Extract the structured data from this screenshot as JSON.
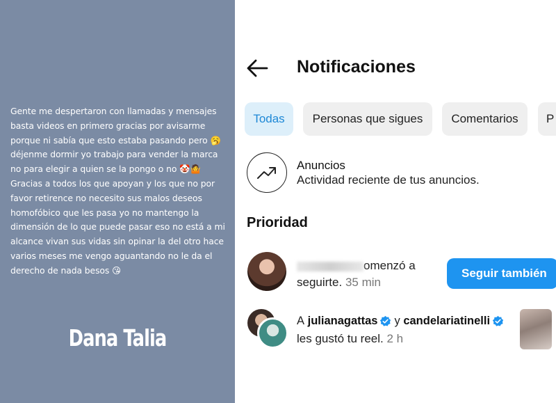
{
  "left_panel": {
    "story_text": "Gente me despertaron  con llamadas y mensajes basta  videos en primero gracias por avisarme porque ni sabía que esto estaba pasando pero 🥱 déjenme dormir  yo trabajo para vender la marca no para elegir a quien se la pongo o no 🤡🤷\nGracias a todos los que apoyan y los que  no por favor retirence no necesito sus malos deseos homofóbico  que les pasa yo no mantengo la dimensión de lo que puede pasar eso no está a mi alcance vivan sus vidas sin opinar la del otro hace varios meses me vengo aguantando  no le da el derecho de nada  besos 😘",
    "brand": "Dana Talia",
    "background_color": "#7b8ba4"
  },
  "header": {
    "back_icon": "arrow-left-icon",
    "title": "Notificaciones"
  },
  "filters": {
    "chips": [
      {
        "label": "Todas",
        "active": true
      },
      {
        "label": "Personas que sigues",
        "active": false
      },
      {
        "label": "Comentarios",
        "active": false
      },
      {
        "label": "P",
        "active": false
      }
    ],
    "active_color": "#1e88d6"
  },
  "ads": {
    "icon": "trending-up-icon",
    "title": "Anuncios",
    "subtitle": "Actividad reciente de tus anuncios."
  },
  "priority": {
    "section_title": "Prioridad",
    "notifications": [
      {
        "text_visible": "omenzó a",
        "text_line2": "seguirte.",
        "time": "35 min",
        "action_label": "Seguir también",
        "action_color": "#1e94f0"
      },
      {
        "prefix": "A",
        "user1": "julianagattas",
        "conjunction": "y",
        "user2": "candelariatinelli",
        "text_line2": "les gustó tu reel.",
        "time": "2 h",
        "verified_color": "#1e94f0"
      }
    ]
  }
}
